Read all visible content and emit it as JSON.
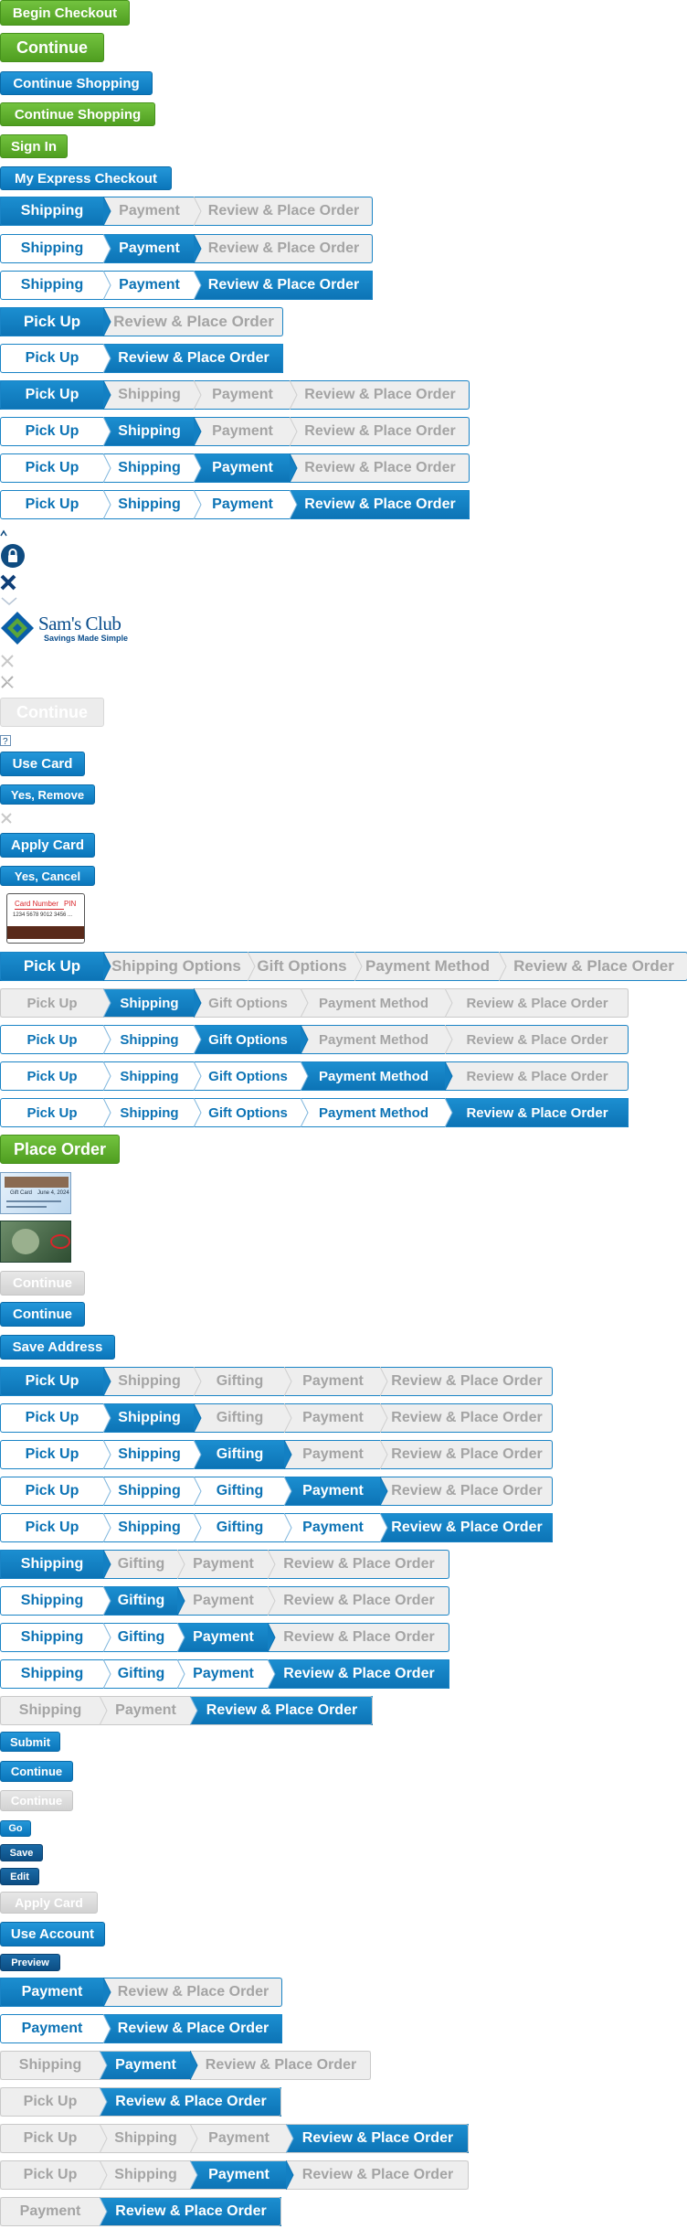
{
  "buttons": {
    "begin_checkout": "Begin Checkout",
    "continue": "Continue",
    "continue_shopping": "Continue Shopping",
    "sign_in": "Sign In",
    "my_express_checkout": "My Express Checkout",
    "use_card": "Use Card",
    "yes_remove": "Yes, Remove",
    "apply_card": "Apply Card",
    "yes_cancel": "Yes, Cancel",
    "place_order": "Place Order",
    "save_address": "Save Address",
    "submit": "Submit",
    "go": "Go",
    "save": "Save",
    "edit": "Edit",
    "use_account": "Use Account",
    "preview": "Preview"
  },
  "logo": {
    "brand": "Sam's Club",
    "tagline": "Savings Made Simple"
  },
  "card_sample": {
    "card_number_label": "Card Number",
    "pin_label": "PIN",
    "number_sample": "1234 5678 9012 3456 ..."
  },
  "gift_card_sample": {
    "line1": "Gift Card",
    "date": "June 4, 2024"
  },
  "step_labels": {
    "shipping": "Shipping",
    "payment": "Payment",
    "review": "Review & Place Order",
    "pickup": "Pick Up",
    "shipping_options": "Shipping Options",
    "gift_options": "Gift Options",
    "payment_method": "Payment Method",
    "gifting": "Gifting"
  },
  "colors": {
    "green": "#5aaa2b",
    "blue": "#1080c4",
    "navy": "#0f5a95",
    "inactive": "#a4a4a4"
  }
}
